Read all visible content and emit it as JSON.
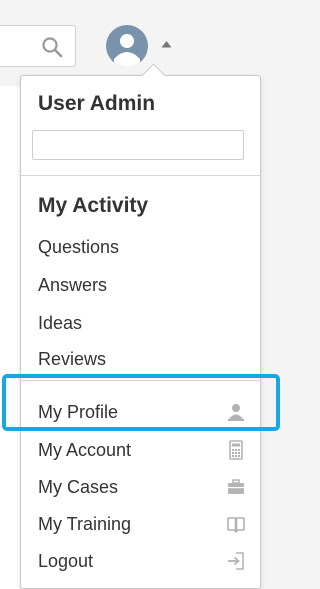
{
  "header": {
    "search_icon": "search-icon",
    "avatar_icon": "user-avatar-icon",
    "dropdown_icon": "caret-up-icon"
  },
  "menu": {
    "title": "User Admin",
    "search_value": "",
    "activity_title": "My Activity",
    "activity_items": [
      {
        "label": "Questions"
      },
      {
        "label": "Answers"
      },
      {
        "label": "Ideas"
      },
      {
        "label": "Reviews"
      }
    ],
    "account_items": [
      {
        "label": "My Profile",
        "icon": "person-icon"
      },
      {
        "label": "My Account",
        "icon": "calculator-icon"
      },
      {
        "label": "My Cases",
        "icon": "briefcase-icon"
      },
      {
        "label": "My Training",
        "icon": "book-icon"
      },
      {
        "label": "Logout",
        "icon": "logout-icon"
      }
    ]
  },
  "colors": {
    "highlight": "#19a7e3",
    "avatar": "#7a93ac",
    "text": "#333333",
    "icon": "#b3b3b3"
  }
}
